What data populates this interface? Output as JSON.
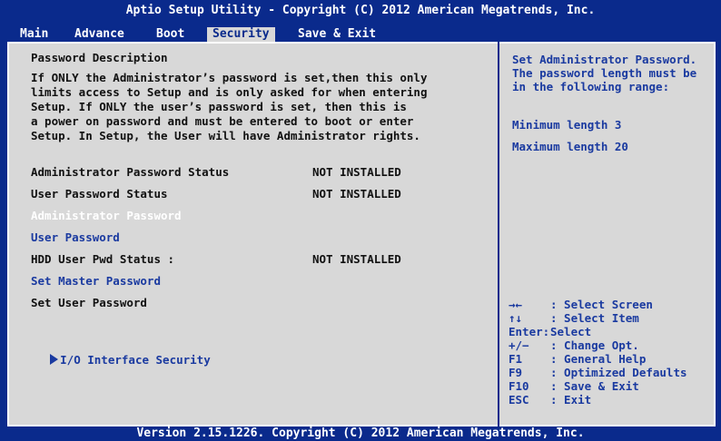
{
  "title": "Aptio Setup Utility - Copyright (C) 2012 American Megatrends, Inc.",
  "tabs": [
    "Main",
    "Advance",
    "Boot",
    "Security",
    "Save & Exit"
  ],
  "active_tab": "Security",
  "left": {
    "section_title": "Password Description",
    "description": [
      "If ONLY the Administrator’s password is set,then this only",
      "limits access to Setup and is only asked for when entering",
      "Setup. If ONLY the user’s password is set, then this is",
      "a power on password and must be entered to boot or enter",
      "Setup. In Setup, the User will have Administrator rights."
    ],
    "admin_status_label": "Administrator Password Status",
    "admin_status_value": "NOT INSTALLED",
    "user_status_label": "User Password Status",
    "user_status_value": "NOT INSTALLED",
    "admin_password": "Administrator Password",
    "user_password": "User Password",
    "hdd_status_label": "HDD User Pwd Status :",
    "hdd_status_value": "NOT INSTALLED",
    "set_master": "Set Master Password",
    "set_user": "Set User Password",
    "io_security": "I/O Interface Security"
  },
  "right": {
    "help": "Set Administrator Password. The password length must be in the following range:",
    "min_length": "Minimum length 3",
    "max_length": "Maximum length 20",
    "keys": [
      {
        "key": "→←",
        "action": ": Select Screen"
      },
      {
        "key": "↑↓",
        "action": ": Select Item"
      },
      {
        "key": "Enter:",
        "action": "Select"
      },
      {
        "key": "+/−",
        "action": ": Change Opt."
      },
      {
        "key": "F1",
        "action": ": General Help"
      },
      {
        "key": "F9",
        "action": ": Optimized Defaults"
      },
      {
        "key": "F10",
        "action": ": Save & Exit"
      },
      {
        "key": "ESC",
        "action": ": Exit"
      }
    ]
  },
  "footer": "Version 2.15.1226. Copyright (C) 2012 American Megatrends, Inc."
}
